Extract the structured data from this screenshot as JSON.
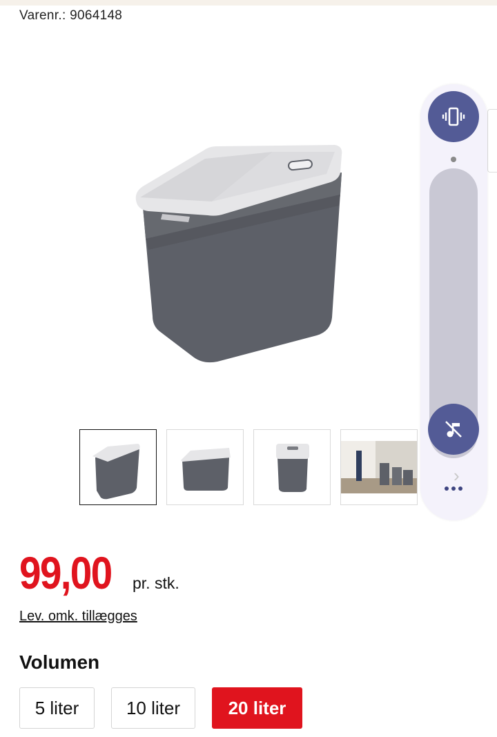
{
  "product": {
    "sku_text": "Varenr.: 9064148"
  },
  "price": {
    "amount": "99,00",
    "unit": "pr. stk.",
    "delivery_link": "Lev. omk. tillægges"
  },
  "volume": {
    "label": "Volumen",
    "options": [
      "5 liter",
      "10 liter",
      "20 liter"
    ],
    "selected": "20 liter"
  },
  "thumbnails": {
    "count": 4,
    "active_index": 0
  },
  "colors": {
    "accent_red": "#e0141e",
    "bin_gray": "#5d6068",
    "lid_white": "#e8e8ea",
    "overlay_button": "#535b96"
  },
  "system_overlay": {
    "icons": [
      "vibrate-icon",
      "music-mute-icon",
      "more-options-icon"
    ]
  }
}
